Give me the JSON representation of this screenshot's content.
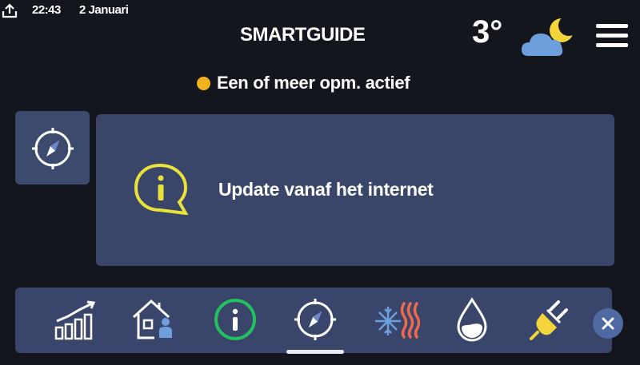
{
  "status_bar": {
    "time": "22:43",
    "date": "2 Januari"
  },
  "header": {
    "title": "SMARTGUIDE",
    "temperature": "3°",
    "weather_icon": "cloudy-night-icon",
    "menu_icon": "hamburger-menu-icon"
  },
  "alert": {
    "text": "Een of meer opm. actief",
    "dot_color": "#f2b21d"
  },
  "card": {
    "icon": "info-speech-bubble-icon",
    "text": "Update vanaf het internet",
    "icon_color": "#e8e23a"
  },
  "bottom_nav": {
    "items": [
      {
        "icon": "statistics-icon"
      },
      {
        "icon": "house-person-icon"
      },
      {
        "icon": "info-icon",
        "active_color": "#24c15f"
      },
      {
        "icon": "compass-icon"
      },
      {
        "icon": "heat-cool-icon"
      },
      {
        "icon": "water-drop-icon"
      },
      {
        "icon": "power-plug-icon"
      }
    ],
    "close_icon": "close-icon"
  },
  "colors": {
    "background": "#14161d",
    "panel": "#3a4669",
    "accent_yellow": "#e8e23a",
    "accent_green": "#24c15f",
    "heat_orange": "#ef6a4a"
  }
}
